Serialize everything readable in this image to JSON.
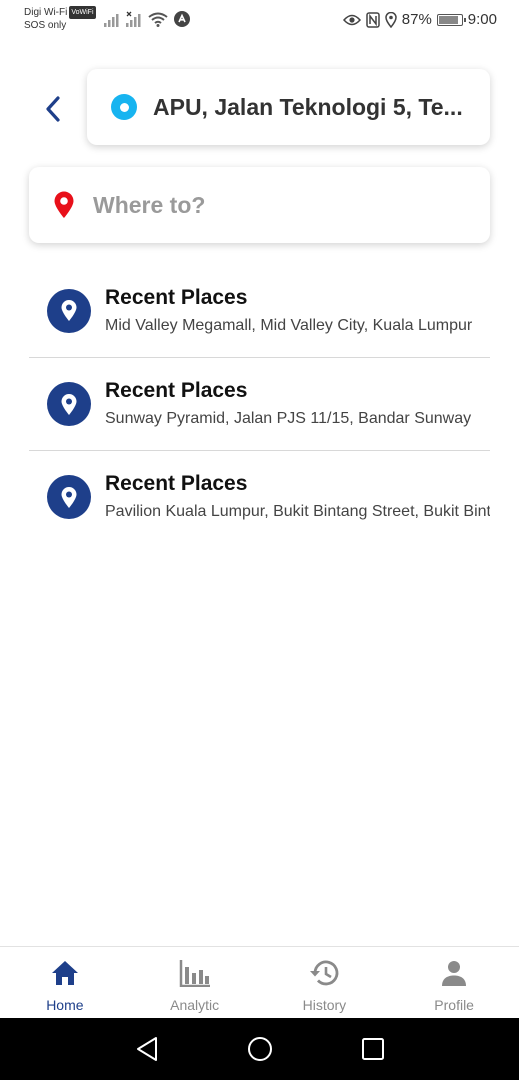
{
  "status_bar": {
    "carrier": "Digi Wi-Fi",
    "vowifi": "VoWiFi",
    "sos": "SOS only",
    "battery": "87%",
    "time": "9:00"
  },
  "origin": {
    "text": "APU, Jalan Teknologi 5, Te..."
  },
  "destination": {
    "placeholder": "Where to?"
  },
  "recent_places": [
    {
      "title": "Recent Places",
      "address": "Mid Valley Megamall, Mid Valley City, Kuala Lumpur"
    },
    {
      "title": "Recent Places",
      "address": "Sunway Pyramid, Jalan PJS 11/15, Bandar Sunway"
    },
    {
      "title": "Recent Places",
      "address": "Pavilion Kuala Lumpur, Bukit Bintang Street, Bukit Bintang"
    }
  ],
  "bottom_nav": {
    "items": [
      {
        "label": "Home",
        "icon": "home-icon",
        "active": true
      },
      {
        "label": "Analytic",
        "icon": "bar-chart-icon",
        "active": false
      },
      {
        "label": "History",
        "icon": "history-icon",
        "active": false
      },
      {
        "label": "Profile",
        "icon": "person-icon",
        "active": false
      }
    ]
  },
  "colors": {
    "primary": "#1e3f8a",
    "origin_dot": "#17b4f0",
    "destination_pin": "#e8101a"
  }
}
